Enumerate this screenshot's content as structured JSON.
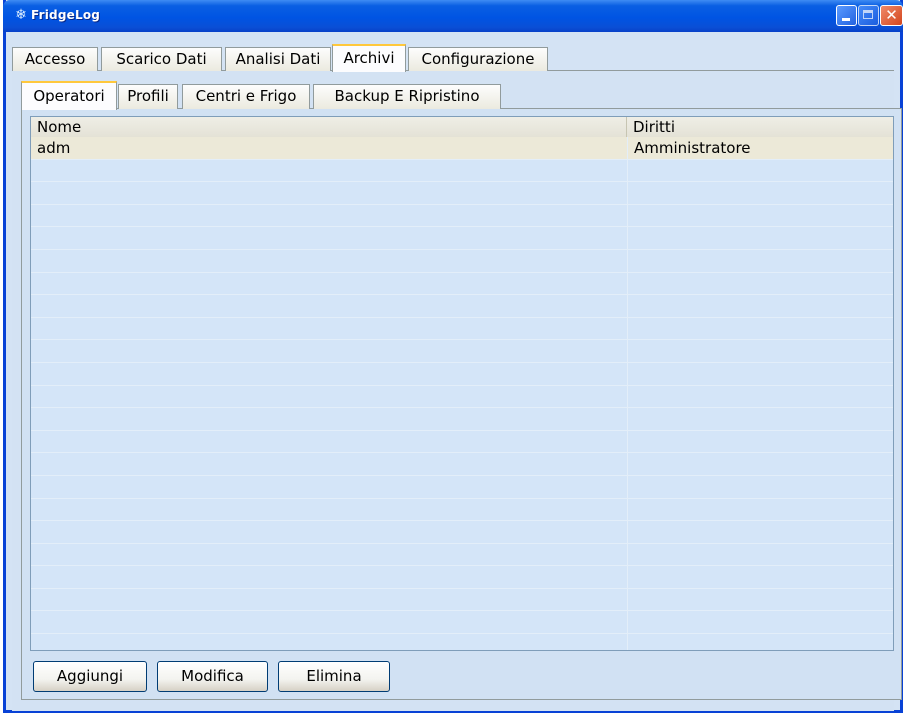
{
  "window": {
    "title": "FridgeLog",
    "icon": "snowflake-icon"
  },
  "main_tabs": [
    {
      "label": "Accesso",
      "selected": false
    },
    {
      "label": "Scarico Dati",
      "selected": false
    },
    {
      "label": "Analisi Dati",
      "selected": false
    },
    {
      "label": "Archivi",
      "selected": true
    },
    {
      "label": "Configurazione",
      "selected": false
    }
  ],
  "sub_tabs": [
    {
      "label": "Operatori",
      "selected": true
    },
    {
      "label": "Profili",
      "selected": false
    },
    {
      "label": "Centri e Frigo",
      "selected": false
    },
    {
      "label": "Backup E Ripristino",
      "selected": false
    }
  ],
  "table": {
    "columns": [
      "Nome",
      "Diritti"
    ],
    "rows": [
      [
        "adm",
        "Amministratore"
      ]
    ]
  },
  "buttons": {
    "add": "Aggiungi",
    "edit": "Modifica",
    "delete": "Elimina"
  },
  "colors": {
    "titlebar": "#0054e3",
    "selected_tab_accent": "#ffc83c",
    "panel_bg": "#d4e3f4",
    "selected_row": "#ece9d8"
  }
}
